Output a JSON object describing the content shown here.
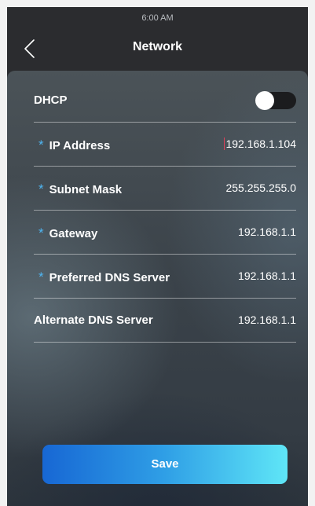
{
  "status_bar": {
    "time": "6:00 AM"
  },
  "nav": {
    "title": "Network",
    "back_icon": "chevron-left-icon"
  },
  "dhcp": {
    "label": "DHCP",
    "enabled": false
  },
  "fields": [
    {
      "label": "IP Address",
      "value": "192.168.1.104",
      "required": true,
      "focused": true
    },
    {
      "label": "Subnet Mask",
      "value": "255.255.255.0",
      "required": true
    },
    {
      "label": "Gateway",
      "value": "192.168.1.1",
      "required": true
    },
    {
      "label": "Preferred DNS Server",
      "value": "192.168.1.1",
      "required": true
    },
    {
      "label": "Alternate DNS Server",
      "value": "192.168.1.1",
      "required": false
    }
  ],
  "required_marker": "*",
  "save_label": "Save",
  "colors": {
    "required_star": "#4fb6f2",
    "save_gradient_start": "#1767d4",
    "save_gradient_end": "#5fe6f7",
    "cursor": "#e0405a"
  }
}
